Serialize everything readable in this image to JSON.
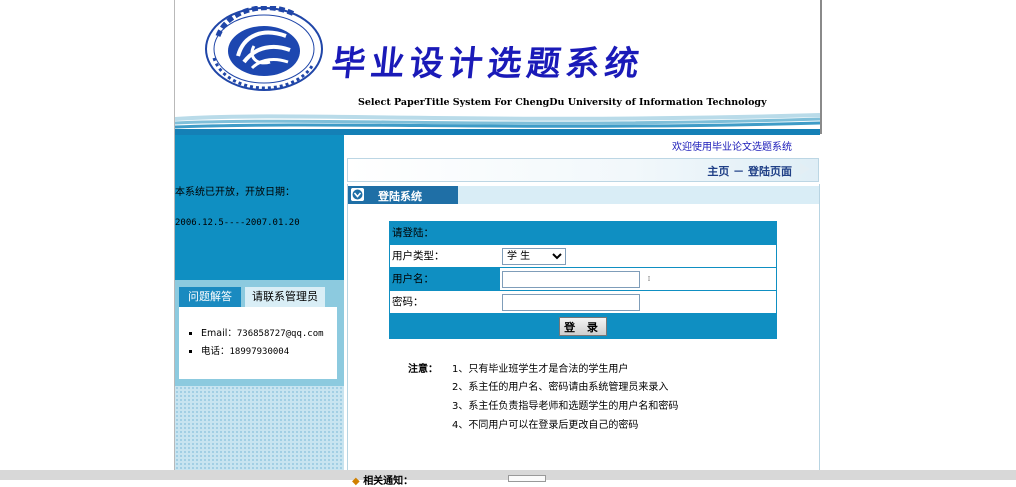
{
  "header": {
    "title_cn": "毕业设计选题系统",
    "title_en": "Select PaperTitle System For ChengDu University of Information Technology",
    "logo_alt": "成都信息工程学院"
  },
  "sidebar": {
    "open_notice": "本系统已开放，开放日期：",
    "open_dates": "2006.12.5----2007.01.20",
    "tabs": [
      {
        "label": "问题解答"
      },
      {
        "label": "请联系管理员"
      }
    ],
    "contacts": [
      {
        "label": "Email：",
        "value": "736858727@qq.com"
      },
      {
        "label": "电话：",
        "value": "18997930004"
      }
    ]
  },
  "main": {
    "welcome": "欢迎使用毕业论文选题系统",
    "breadcrumb": "主页 － 登陆页面",
    "section_title": "登陆系统",
    "login": {
      "prompt": "请登陆：",
      "usertype_label": "用户类型：",
      "usertype_value": "学 生",
      "username_label": "用户名：",
      "username_value": "",
      "password_label": "密码：",
      "password_value": "",
      "submit_label": "登 录"
    },
    "notes_label": "注意：",
    "notes": [
      "1、只有毕业班学生才是合法的学生用户",
      "2、系主任的用户名、密码请由系统管理员来录入",
      "3、系主任负责指导老师和选题学生的用户名和密码",
      "4、不同用户可以在登录后更改自己的密码"
    ],
    "related_label": "相关通知："
  },
  "colors": {
    "primary_blue": "#0f8fc2",
    "title_blue": "#1a1ab8",
    "light_blue": "#8ccadf"
  }
}
